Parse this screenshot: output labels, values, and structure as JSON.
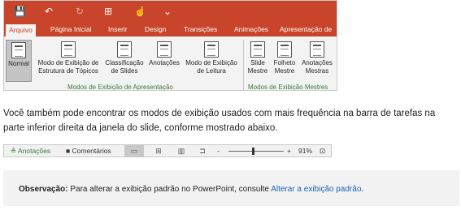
{
  "ribbon": {
    "qat": {
      "save_icon": "💾",
      "undo_icon": "↶",
      "redo_icon": "↻",
      "present_icon": "⊞",
      "touch_icon": "☝",
      "customize_icon": "⌄"
    },
    "tabs": [
      "Arquivo",
      "Página Inicial",
      "Inserir",
      "Design",
      "Transições",
      "Animações",
      "Apresentação de"
    ],
    "buttons": [
      {
        "label1": "Normal",
        "label2": ""
      },
      {
        "label1": "Modo de Exibição de",
        "label2": "Estrutura de Tópicos"
      },
      {
        "label1": "Classificação",
        "label2": "de Slides"
      },
      {
        "label1": "Anotações",
        "label2": ""
      },
      {
        "label1": "Modo de Exibição",
        "label2": "de Leitura"
      },
      {
        "label1": "Slide",
        "label2": "Mestre"
      },
      {
        "label1": "Folheto",
        "label2": "Mestre"
      },
      {
        "label1": "Anotações",
        "label2": "Mestras"
      }
    ],
    "groups": [
      "Modos de Exibição de Apresentação",
      "Modos de Exibição Mestres"
    ]
  },
  "paragraph": "Você também pode encontrar os modos de exibição usados com mais frequência na barra de tarefas na parte inferior direita da janela do slide, conforme mostrado abaixo.",
  "statusbar": {
    "notes_label": "≜ Anotações",
    "comments_label": "■ Comentários",
    "minus": "-",
    "plus": "+",
    "zoom": "91%",
    "fit_icon": "⊡"
  },
  "note": {
    "bold": "Observação:",
    "text": " Para alterar a exibição padrão no PowerPoint, consulte ",
    "link": "Alterar a exibição padrão",
    "end": "."
  }
}
